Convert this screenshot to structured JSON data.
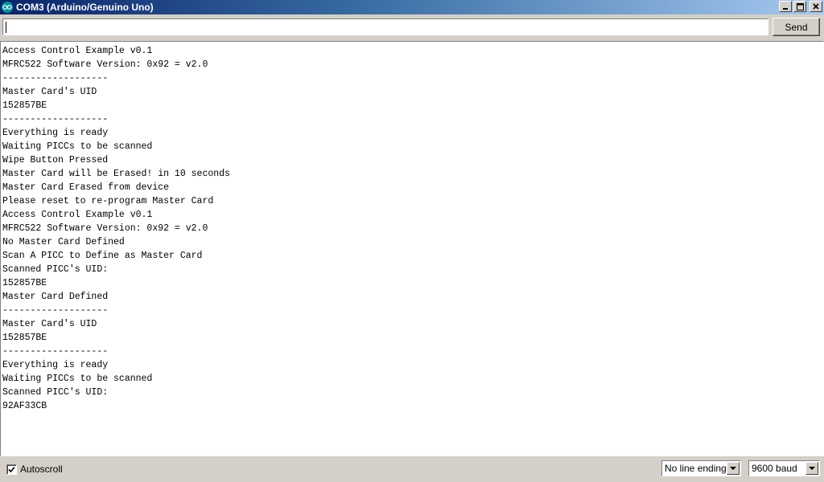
{
  "window": {
    "title": "COM3 (Arduino/Genuino Uno)",
    "logo_icon": "arduino-logo-icon",
    "controls": [
      "minimize-icon",
      "maximize-icon",
      "close-icon"
    ],
    "title_bar_color": "#0a246a",
    "logo_color": "#00979c"
  },
  "send_bar": {
    "input_value": "",
    "send_label": "Send"
  },
  "output": {
    "lines": [
      "Access Control Example v0.1",
      "MFRC522 Software Version: 0x92 = v2.0",
      "-------------------",
      "Master Card's UID",
      "152857BE",
      "-------------------",
      "Everything is ready",
      "Waiting PICCs to be scanned",
      "Wipe Button Pressed",
      "Master Card will be Erased! in 10 seconds",
      "Master Card Erased from device",
      "Please reset to re-program Master Card",
      "Access Control Example v0.1",
      "MFRC522 Software Version: 0x92 = v2.0",
      "No Master Card Defined",
      "Scan A PICC to Define as Master Card",
      "Scanned PICC's UID:",
      "152857BE",
      "Master Card Defined",
      "-------------------",
      "Master Card's UID",
      "152857BE",
      "-------------------",
      "Everything is ready",
      "Waiting PICCs to be scanned",
      "Scanned PICC's UID:",
      "92AF33CB"
    ]
  },
  "bottom_bar": {
    "autoscroll_label": "Autoscroll",
    "autoscroll_checked": true,
    "line_ending_value": "No line ending",
    "baud_value": "9600 baud"
  }
}
